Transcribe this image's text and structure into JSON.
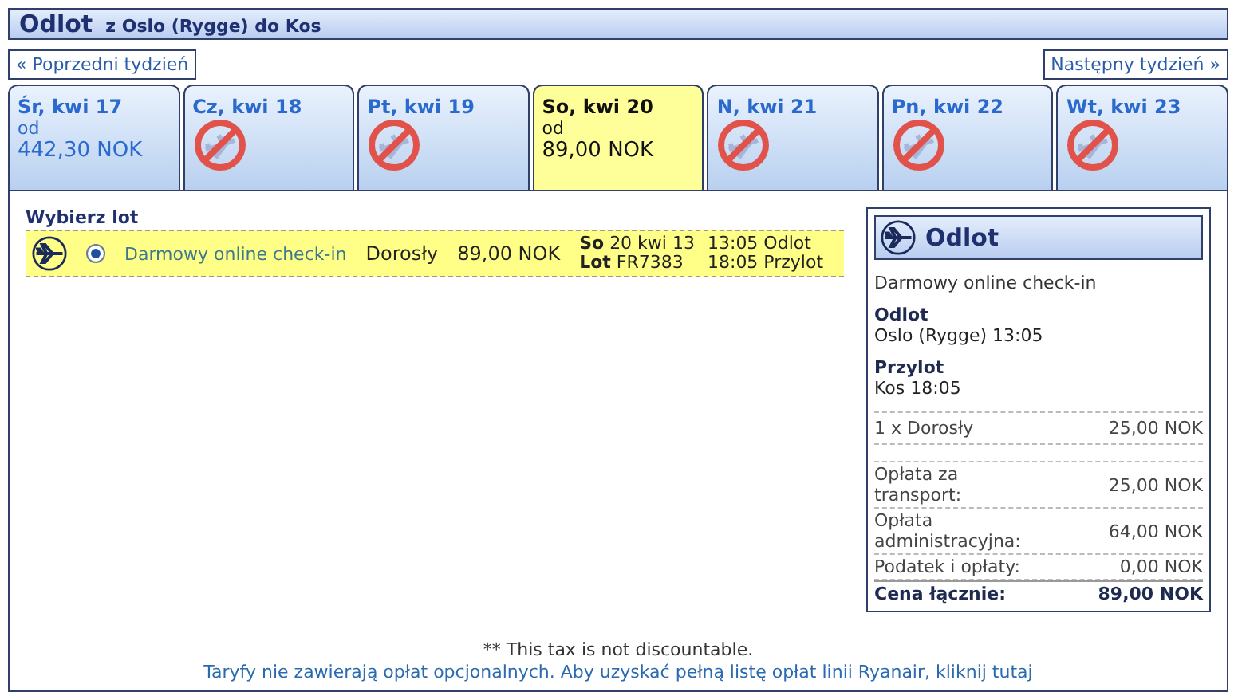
{
  "header": {
    "title": "Odlot",
    "route": "z Oslo (Rygge) do Kos"
  },
  "nav": {
    "previous": "« Poprzedni tydzień",
    "next": "Następny tydzień »"
  },
  "days": [
    {
      "label": "Śr, kwi 17",
      "kind": "fare",
      "selected": false,
      "from": "od",
      "price": "442,30 NOK"
    },
    {
      "label": "Cz, kwi 18",
      "kind": "unavailable",
      "selected": false
    },
    {
      "label": "Pt, kwi 19",
      "kind": "unavailable",
      "selected": false
    },
    {
      "label": "So, kwi 20",
      "kind": "fare",
      "selected": true,
      "from": "od",
      "price": "89,00 NOK"
    },
    {
      "label": "N, kwi 21",
      "kind": "unavailable",
      "selected": false
    },
    {
      "label": "Pn, kwi 22",
      "kind": "unavailable",
      "selected": false
    },
    {
      "label": "Wt, kwi 23",
      "kind": "unavailable",
      "selected": false
    }
  ],
  "flights": {
    "heading": "Wybierz lot",
    "rows": [
      {
        "selected": true,
        "fare": "Darmowy online check-in",
        "passenger": "Dorosły",
        "price": "89,00 NOK",
        "day_label": "So",
        "date": "20 kwi 13",
        "flight_label": "Lot",
        "flight": "FR7383",
        "depart": "13:05 Odlot",
        "arrive": "18:05 Przylot"
      }
    ]
  },
  "summary": {
    "title": "Odlot",
    "fare": "Darmowy online check-in",
    "depart_label": "Odlot",
    "depart": "Oslo (Rygge) 13:05",
    "arrive_label": "Przylot",
    "arrive": "Kos 18:05",
    "passengers": [
      {
        "label": "1 x Dorosły",
        "value": "25,00 NOK"
      }
    ],
    "fees": [
      {
        "label": "Opłata za transport:",
        "value": "25,00 NOK"
      },
      {
        "label": "Opłata administracyjna:",
        "value": "64,00 NOK"
      },
      {
        "label": "Podatek i opłaty:",
        "value": "0,00 NOK"
      }
    ],
    "total": {
      "label": "Cena łącznie:",
      "value": "89,00 NOK"
    }
  },
  "footer": {
    "note": "** This tax is not discountable.",
    "link": "Taryfy nie zawierają opłat opcjonalnych. Aby uzyskać pełną listę opłat linii Ryanair, kliknij tutaj"
  }
}
